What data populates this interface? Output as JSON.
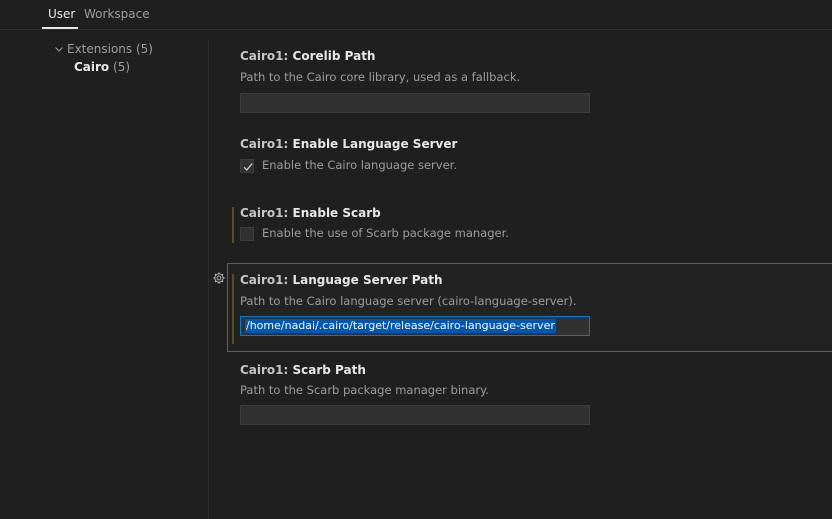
{
  "tabs": {
    "user": "User",
    "workspace": "Workspace"
  },
  "toc": {
    "extensions": "Extensions (5)",
    "cairo_name": "Cairo",
    "cairo_count": "(5)"
  },
  "settings": [
    {
      "category": "Cairo1: ",
      "name": "Corelib Path",
      "description": "Path to the Cairo core library, used as a fallback.",
      "value": ""
    },
    {
      "category": "Cairo1: ",
      "name": "Enable Language Server",
      "checkbox_label": "Enable the Cairo language server.",
      "checked": true
    },
    {
      "category": "Cairo1: ",
      "name": "Enable Scarb",
      "checkbox_label": "Enable the use of Scarb package manager.",
      "checked": false
    },
    {
      "category": "Cairo1: ",
      "name": "Language Server Path",
      "description": "Path to the Cairo language server (cairo-language-server).",
      "value": "/home/nadai/.cairo/target/release/cairo-language-server"
    },
    {
      "category": "Cairo1: ",
      "name": "Scarb Path",
      "description": "Path to the Scarb package manager binary.",
      "value": ""
    }
  ],
  "colors": {
    "accent": "#0078d4",
    "background": "#1f1f1f",
    "modified": "#5a4f1a"
  }
}
